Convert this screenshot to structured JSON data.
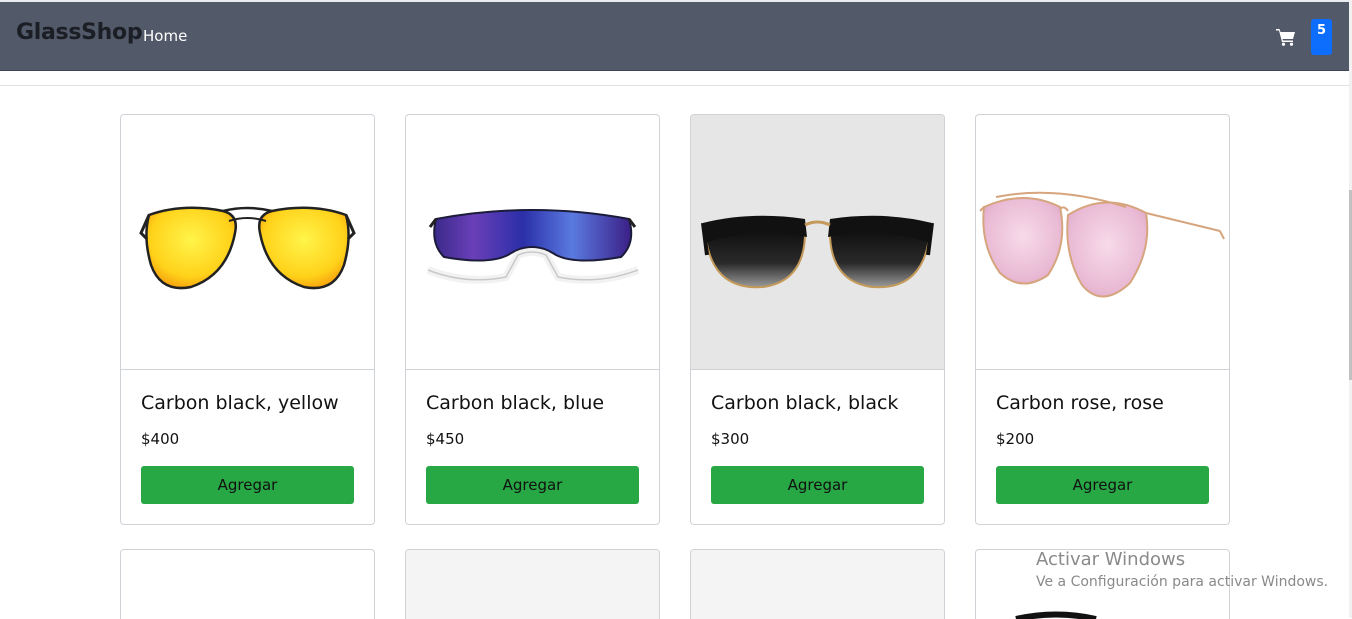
{
  "navbar": {
    "brand": "GlassShop",
    "home_label": "Home",
    "cart_icon": "shopping-cart-icon",
    "cart_count": "5"
  },
  "products": [
    {
      "name": "Carbon black, yellow",
      "price": "$400",
      "button_label": "Agregar"
    },
    {
      "name": "Carbon black, blue",
      "price": "$450",
      "button_label": "Agregar"
    },
    {
      "name": "Carbon black, black",
      "price": "$300",
      "button_label": "Agregar"
    },
    {
      "name": "Carbon rose, rose",
      "price": "$200",
      "button_label": "Agregar"
    }
  ],
  "watermark": {
    "title": "Activar Windows",
    "subtitle": "Ve a Configuración para activar Windows."
  },
  "colors": {
    "navbar_bg": "#525968",
    "button_green": "#28a745",
    "badge_blue": "#0d6efd"
  }
}
